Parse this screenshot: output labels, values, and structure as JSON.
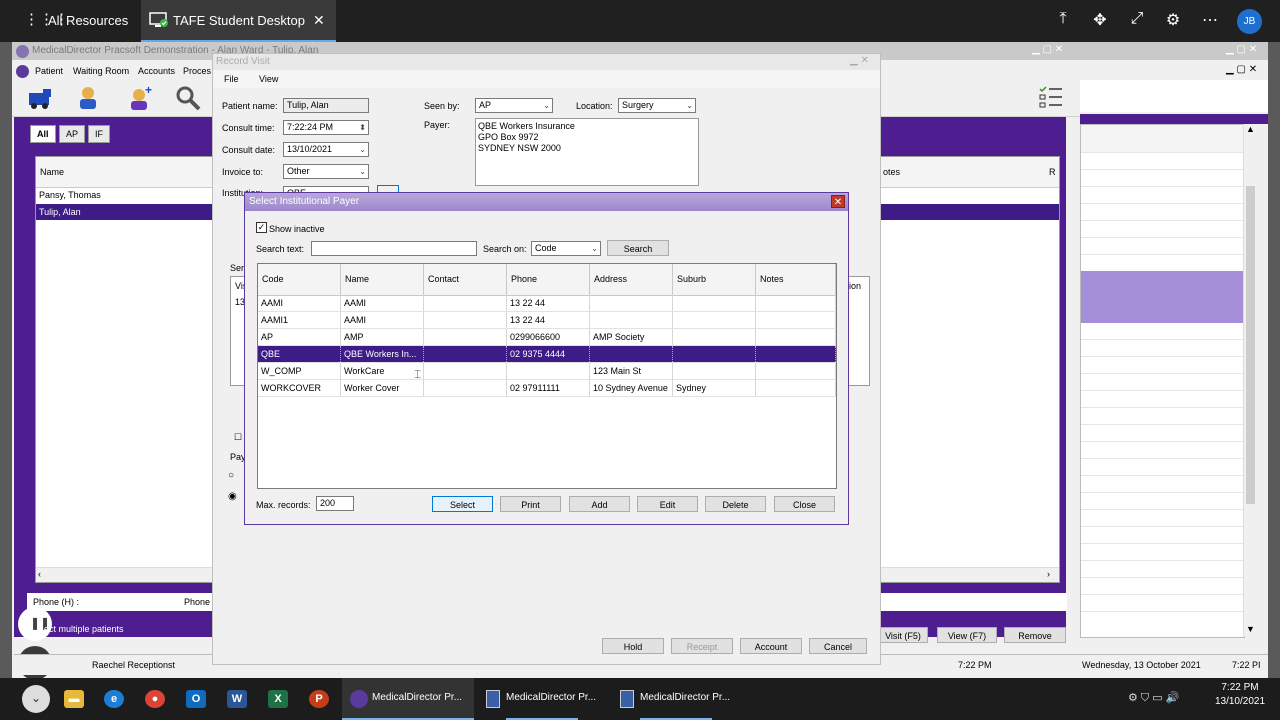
{
  "remote_bar": {
    "all_resources": "All Resources",
    "tab_title": "TAFE Student Desktop",
    "avatar_initials": "JB"
  },
  "main_window": {
    "title": "MedicalDirector Pracsoft Demonstration - Alan Ward - Tulip, Alan",
    "menu": [
      "Patient",
      "Waiting Room",
      "Accounts",
      "Proces"
    ],
    "patient_tabs": [
      "All",
      "AP",
      "IF"
    ],
    "patient_list_header": "Name",
    "patients": [
      "Pansy, Thomas",
      "Tulip, Alan"
    ],
    "right_header": "otes",
    "right_header_r": "R",
    "phone_h_label": "Phone (H) :",
    "phone_label": "Phone",
    "select_multiple": "ect multiple patients",
    "user": "Raechel Receptionst",
    "status_time": "7:22 PM",
    "status_date": "Wednesday, 13 October 2021",
    "status_time2": "7:22 PI",
    "bottom_buttons": [
      "Visit (F5)",
      "View (F7)",
      "Remove"
    ]
  },
  "record_visit": {
    "title": "Record Visit",
    "menu": [
      "File",
      "View"
    ],
    "patient_name_label": "Patient name:",
    "patient_name": "Tulip, Alan",
    "consult_time_label": "Consult time:",
    "consult_time": "7:22:24 PM",
    "consult_date_label": "Consult date:",
    "consult_date": "13/10/2021",
    "invoice_to_label": "Invoice to:",
    "invoice_to": "Other",
    "institution_label": "Institution:",
    "institution": "QBE",
    "seen_by_label": "Seen by:",
    "seen_by": "AP",
    "location_label": "Location:",
    "location": "Surgery",
    "payer_label": "Payer:",
    "payer_lines": [
      "QBE Workers Insurance",
      "GPO Box 9972",
      "SYDNEY   NSW   2000"
    ],
    "ser_label": "Ser",
    "vis_label": "Vis",
    "row_13": "13",
    "cation_label": "cation",
    "pay_label": "Pay",
    "n_label": "n",
    "buttons": {
      "hold": "Hold",
      "receipt": "Receipt",
      "account": "Account",
      "cancel": "Cancel"
    }
  },
  "dialog": {
    "title": "Select Institutional Payer",
    "show_inactive": "Show inactive",
    "search_text_label": "Search text:",
    "search_text_value": "",
    "search_on_label": "Search on:",
    "search_on_value": "Code",
    "search_button": "Search",
    "columns": [
      "Code",
      "Name",
      "Contact",
      "Phone",
      "Address",
      "Suburb",
      "Notes"
    ],
    "rows": [
      {
        "code": "AAMI",
        "name": "AAMI",
        "contact": "",
        "phone": "13 22 44",
        "address": "",
        "suburb": "",
        "notes": ""
      },
      {
        "code": "AAMI1",
        "name": "AAMI",
        "contact": "",
        "phone": "13 22 44",
        "address": "",
        "suburb": "",
        "notes": ""
      },
      {
        "code": "AP",
        "name": "AMP",
        "contact": "",
        "phone": "0299066600",
        "address": "AMP Society",
        "suburb": "",
        "notes": ""
      },
      {
        "code": "QBE",
        "name": "QBE Workers In...",
        "contact": "",
        "phone": "02 9375 4444",
        "address": "",
        "suburb": "",
        "notes": ""
      },
      {
        "code": "W_COMP",
        "name": "WorkCare",
        "contact": "",
        "phone": "",
        "address": "123 Main St",
        "suburb": "",
        "notes": ""
      },
      {
        "code": "WORKCOVER",
        "name": "Worker Cover",
        "contact": "",
        "phone": "02 97911111",
        "address": "10 Sydney Avenue",
        "suburb": "Sydney",
        "notes": ""
      }
    ],
    "selected_row": 3,
    "max_records_label": "Max. records:",
    "max_records": "200",
    "buttons": {
      "select": "Select",
      "print": "Print",
      "add": "Add",
      "edit": "Edit",
      "delete": "Delete",
      "close": "Close"
    }
  },
  "taskbar": {
    "items": [
      "MedicalDirector Pr...",
      "MedicalDirector Pr...",
      "MedicalDirector Pr..."
    ],
    "clock_time": "7:22 PM",
    "clock_date": "13/10/2021"
  }
}
